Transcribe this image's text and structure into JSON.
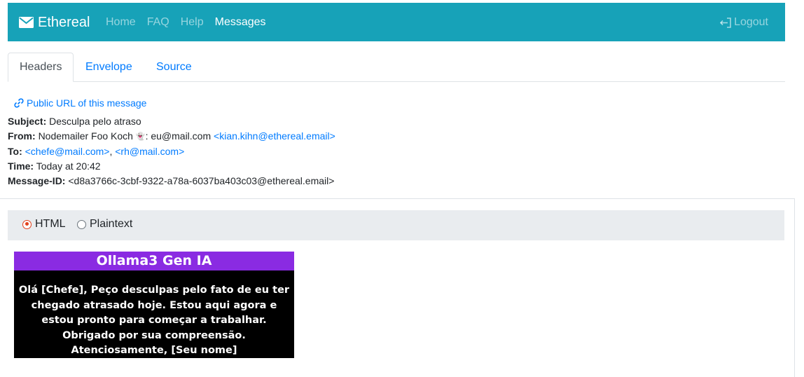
{
  "nav": {
    "brand": "Ethereal",
    "links": [
      "Home",
      "FAQ",
      "Help",
      "Messages"
    ],
    "logout": "Logout"
  },
  "tabs": [
    "Headers",
    "Envelope",
    "Source"
  ],
  "public_url": "Public URL of this message",
  "headers": {
    "subject_label": "Subject:",
    "subject": "Desculpa pelo atraso",
    "from_label": "From:",
    "from_name": "Nodemailer Foo Koch",
    "from_emoji": "👻",
    "from_extra": ": eu@mail.com",
    "from_email": "<kian.kihn@ethereal.email>",
    "to_label": "To:",
    "to_1": "<chefe@mail.com>",
    "to_sep": ",",
    "to_2": "<rh@mail.com>",
    "time_label": "Time:",
    "time": "Today at 20:42",
    "messageid_label": "Message-ID:",
    "messageid": "<d8a3766c-3cbf-9322-a78a-6037ba403c03@ethereal.email>"
  },
  "view": {
    "html": "HTML",
    "plaintext": "Plaintext",
    "selected": "HTML"
  },
  "email": {
    "title": "Ollama3 Gen IA",
    "body": "Olá [Chefe], Peço desculpas pelo fato de eu ter chegado atrasado hoje. Estou aqui agora e estou pronto para começar a trabalhar. Obrigado por sua compreensão. Atenciosamente, [Seu nome]"
  },
  "colors": {
    "navbar": "#17a2b8",
    "link": "#007bff",
    "email_title_bg": "#8a2be2",
    "radio_checked": "#e2401c"
  }
}
